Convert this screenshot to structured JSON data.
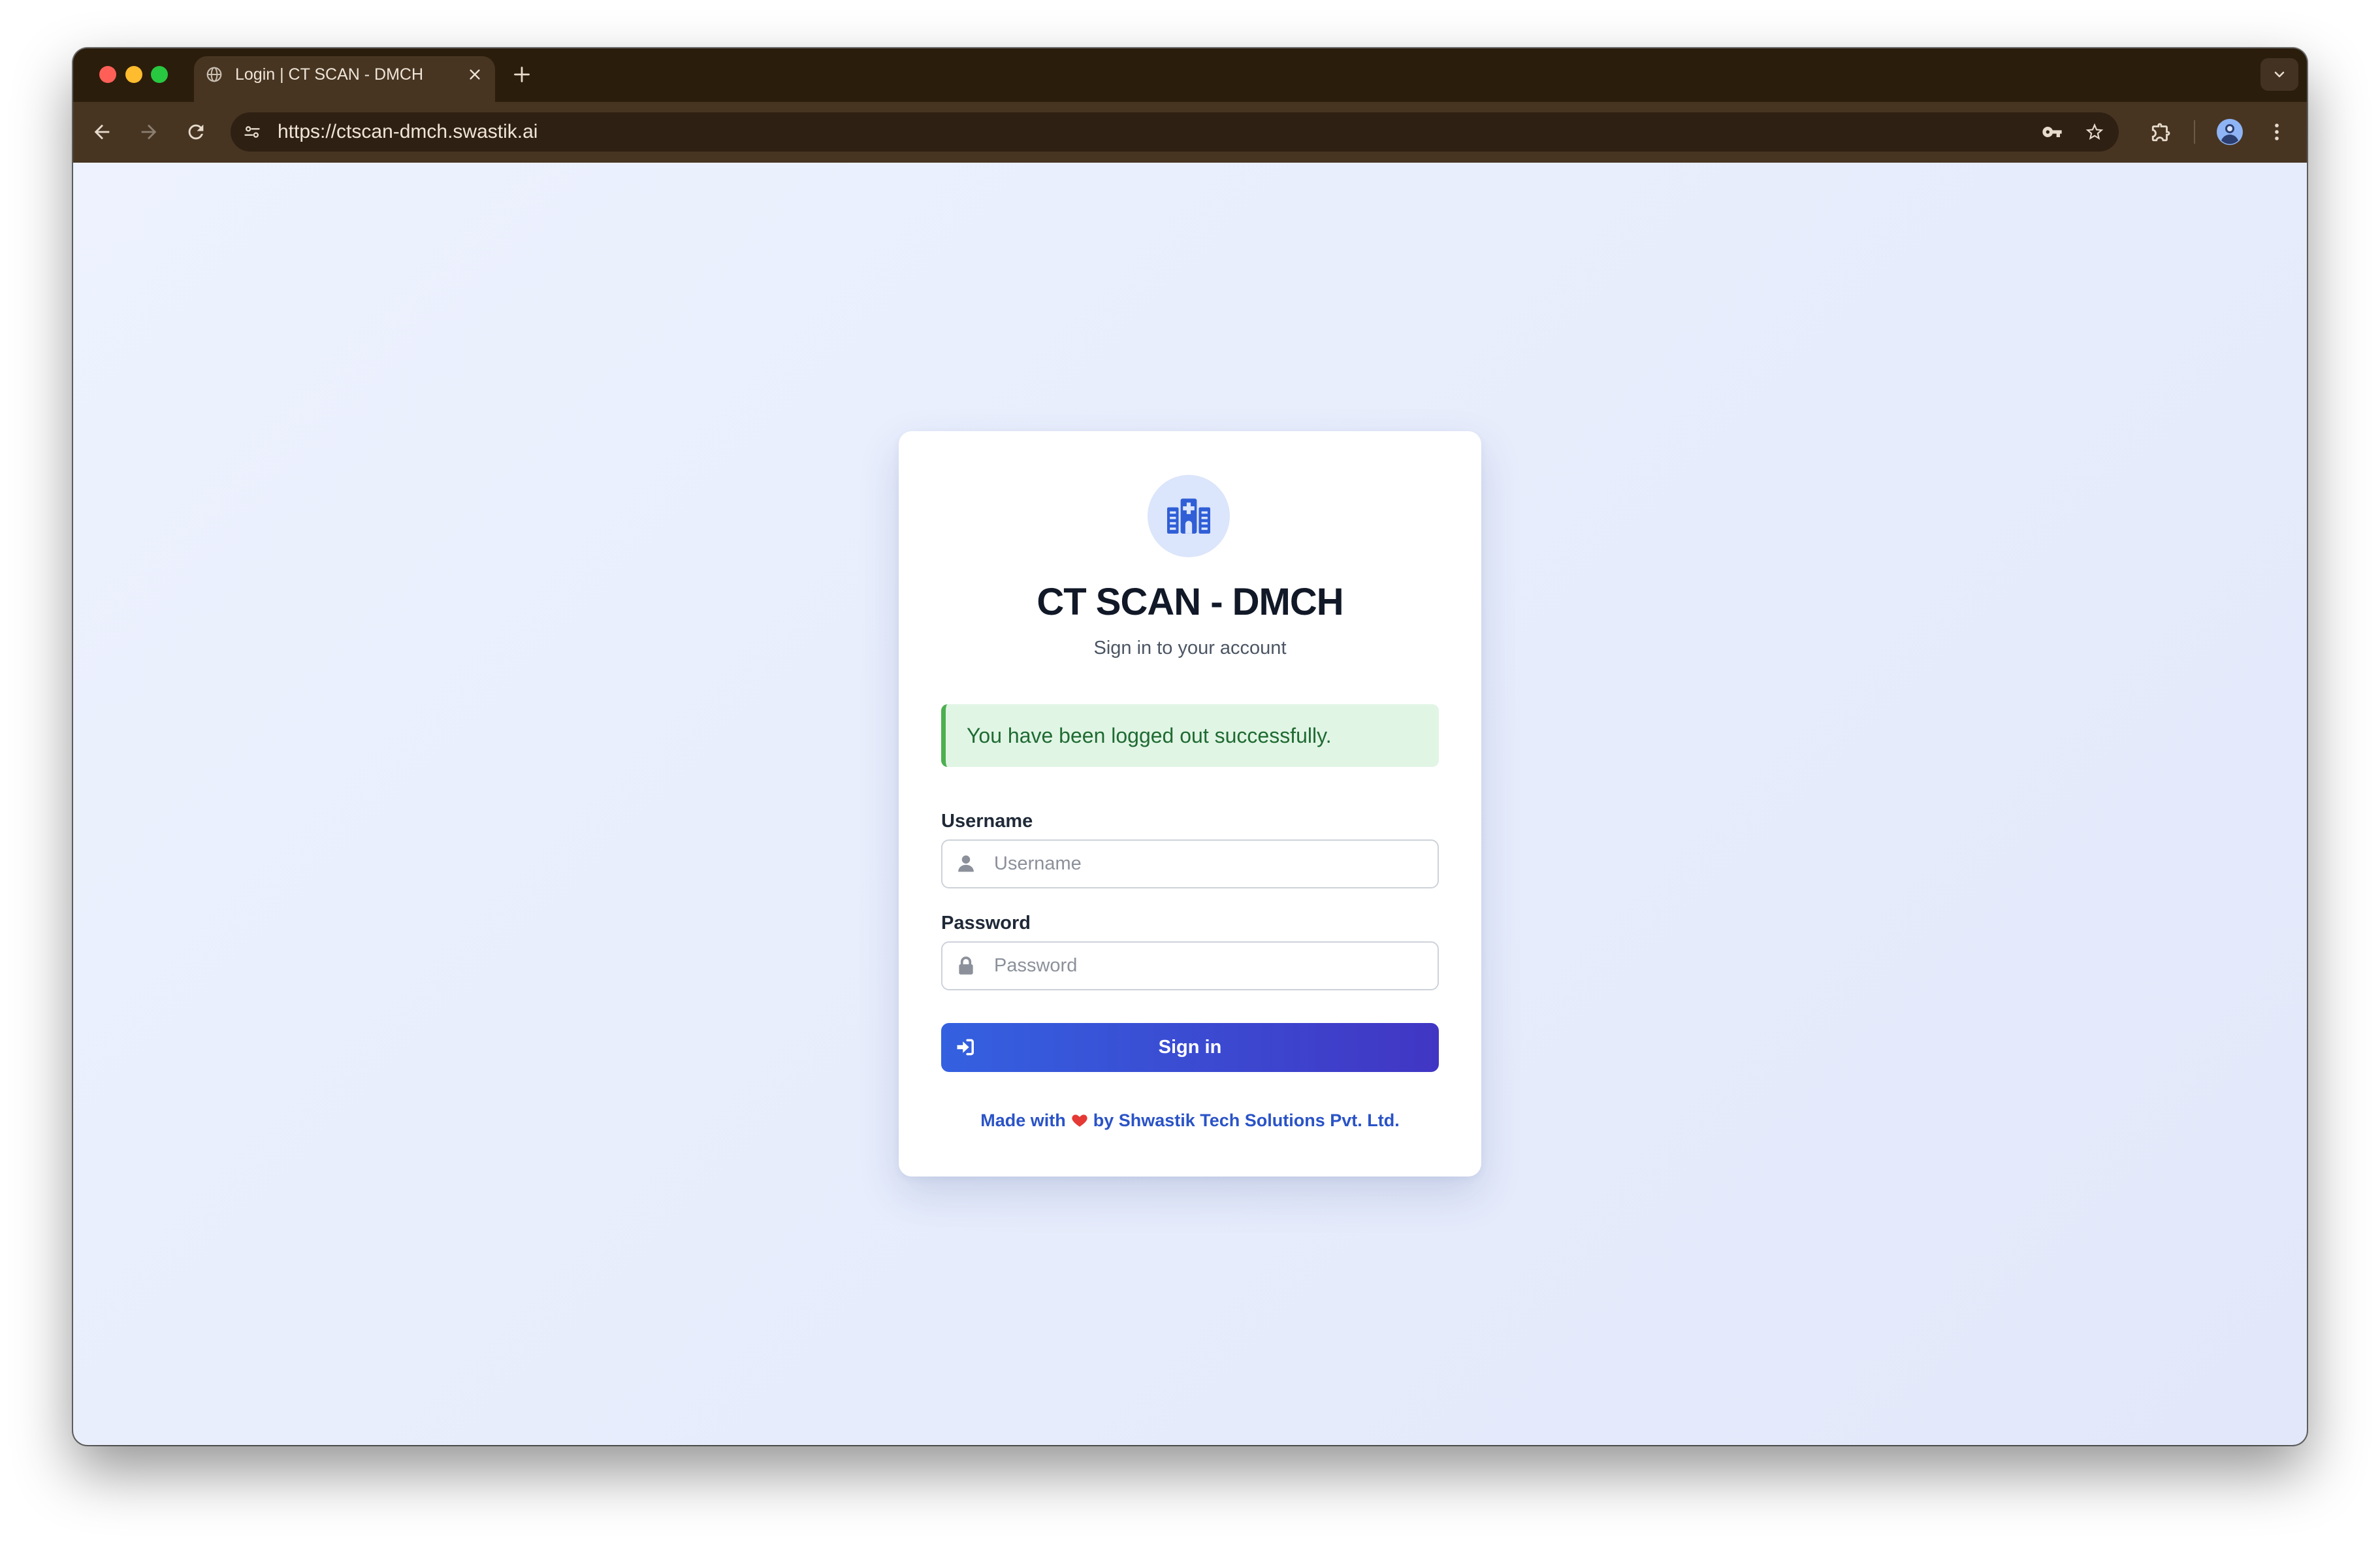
{
  "window": {
    "traffic_lights": {
      "close": "#ff5f57",
      "minimize": "#febc2e",
      "zoom": "#28c840"
    }
  },
  "browser": {
    "tab": {
      "title": "Login | CT SCAN - DMCH",
      "favicon_icon": "globe-icon",
      "close_icon": "close-icon"
    },
    "new_tab_icon": "plus-icon",
    "tab_search_icon": "chevron-down-icon",
    "toolbar": {
      "back_icon": "arrow-left-icon",
      "forward_icon": "arrow-right-icon",
      "forward_enabled": false,
      "reload_icon": "reload-icon",
      "site_info_icon": "tune-icon",
      "url": "https://ctscan-dmch.swastik.ai",
      "password_manager_icon": "key-icon",
      "bookmark_icon": "star-outline-icon",
      "extensions_icon": "puzzle-icon",
      "profile_icon": "avatar-icon",
      "menu_icon": "more-vert-icon"
    }
  },
  "login": {
    "logo_icon": "hospital-icon",
    "app_title": "CT SCAN - DMCH",
    "subtitle": "Sign in to your account",
    "alert": {
      "type": "success",
      "message": "You have been logged out successfully."
    },
    "username": {
      "label": "Username",
      "placeholder": "Username",
      "value": "",
      "icon": "user-icon"
    },
    "password": {
      "label": "Password",
      "placeholder": "Password",
      "value": "",
      "icon": "lock-icon"
    },
    "submit": {
      "label": "Sign in",
      "icon": "sign-in-icon"
    },
    "footer": {
      "prefix": "Made with",
      "icon": "heart-icon",
      "suffix": "by Shwastik Tech Solutions Pvt. Ltd."
    }
  },
  "colors": {
    "tabstrip": "#2b1d0c",
    "toolbar": "#473522",
    "omnibox": "#2e2012",
    "page_bg_start": "#edf2fe",
    "page_bg_end": "#e2e8fa",
    "icon_circle": "#dbe5fb",
    "icon_blue": "#2f5ed6",
    "alert_bg": "#e1f5e5",
    "alert_border": "#4caf50",
    "alert_text": "#1f6b32",
    "accent_start": "#3461e0",
    "accent_end": "#4136c4",
    "link": "#2a53c7",
    "heart": "#e53935"
  }
}
